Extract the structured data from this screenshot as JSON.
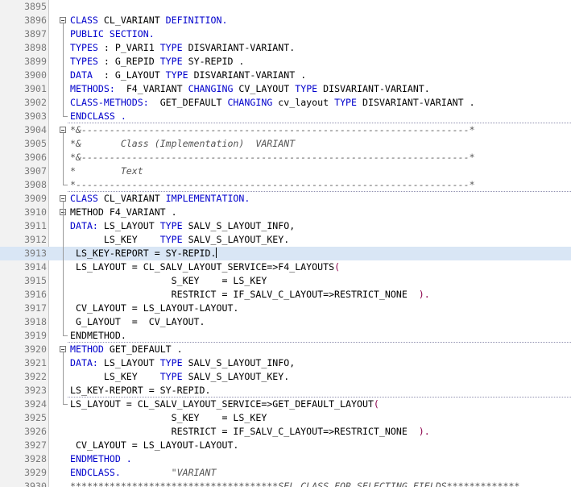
{
  "editor": {
    "lines": [
      {
        "no": "3895",
        "tokens": []
      },
      {
        "no": "3896",
        "tokens": [
          {
            "t": "CLASS ",
            "c": "kw"
          },
          {
            "t": "CL_VARIANT ",
            "c": "pl"
          },
          {
            "t": "DEFINITION.",
            "c": "kw"
          }
        ]
      },
      {
        "no": "3897",
        "tokens": [
          {
            "t": "PUBLIC SECTION.",
            "c": "kw"
          }
        ]
      },
      {
        "no": "3898",
        "tokens": [
          {
            "t": "TYPES ",
            "c": "kw"
          },
          {
            "t": ": P_VARI1 ",
            "c": "pl"
          },
          {
            "t": "TYPE ",
            "c": "kw"
          },
          {
            "t": "DISVARIANT-VARIANT.",
            "c": "pl"
          }
        ]
      },
      {
        "no": "3899",
        "tokens": [
          {
            "t": "TYPES ",
            "c": "kw"
          },
          {
            "t": ": G_REPID ",
            "c": "pl"
          },
          {
            "t": "TYPE ",
            "c": "kw"
          },
          {
            "t": "SY-REPID .",
            "c": "pl"
          }
        ]
      },
      {
        "no": "3900",
        "tokens": [
          {
            "t": "DATA  ",
            "c": "kw"
          },
          {
            "t": ": G_LAYOUT ",
            "c": "pl"
          },
          {
            "t": "TYPE ",
            "c": "kw"
          },
          {
            "t": "DISVARIANT-VARIANT .",
            "c": "pl"
          }
        ]
      },
      {
        "no": "3901",
        "tokens": [
          {
            "t": "METHODS:  ",
            "c": "kw"
          },
          {
            "t": "F4_VARIANT ",
            "c": "pl"
          },
          {
            "t": "CHANGING ",
            "c": "kw"
          },
          {
            "t": "CV_LAYOUT ",
            "c": "pl"
          },
          {
            "t": "TYPE ",
            "c": "kw"
          },
          {
            "t": "DISVARIANT-VARIANT.",
            "c": "pl"
          }
        ]
      },
      {
        "no": "3902",
        "tokens": [
          {
            "t": "CLASS-METHODS:  ",
            "c": "kw"
          },
          {
            "t": "GET_DEFAULT ",
            "c": "pl"
          },
          {
            "t": "CHANGING ",
            "c": "kw"
          },
          {
            "t": "cv_layout ",
            "c": "pl"
          },
          {
            "t": "TYPE ",
            "c": "kw"
          },
          {
            "t": "DISVARIANT-VARIANT .",
            "c": "pl"
          }
        ]
      },
      {
        "no": "3903",
        "tokens": [
          {
            "t": "ENDCLASS .",
            "c": "kw"
          }
        ]
      },
      {
        "no": "3904",
        "tokens": [
          {
            "t": "*&---------------------------------------------------------------------*",
            "c": "cmt"
          }
        ]
      },
      {
        "no": "3905",
        "tokens": [
          {
            "t": "*&       Class (Implementation)  VARIANT",
            "c": "cmt"
          }
        ]
      },
      {
        "no": "3906",
        "tokens": [
          {
            "t": "*&---------------------------------------------------------------------*",
            "c": "cmt"
          }
        ]
      },
      {
        "no": "3907",
        "tokens": [
          {
            "t": "*        Text",
            "c": "cmt"
          }
        ]
      },
      {
        "no": "3908",
        "tokens": [
          {
            "t": "*----------------------------------------------------------------------*",
            "c": "cmt"
          }
        ]
      },
      {
        "no": "3909",
        "tokens": [
          {
            "t": "CLASS ",
            "c": "kw"
          },
          {
            "t": "CL_VARIANT ",
            "c": "pl"
          },
          {
            "t": "IMPLEMENTATION.",
            "c": "kw"
          }
        ]
      },
      {
        "no": "3910",
        "tokens": [
          {
            "t": "METHOD F4_VARIANT .",
            "c": "pl"
          }
        ]
      },
      {
        "no": "3911",
        "tokens": [
          {
            "t": "DATA: ",
            "c": "kw"
          },
          {
            "t": "LS_LAYOUT ",
            "c": "pl"
          },
          {
            "t": "TYPE ",
            "c": "kw"
          },
          {
            "t": "SALV_S_LAYOUT_INFO,",
            "c": "pl"
          }
        ]
      },
      {
        "no": "3912",
        "tokens": [
          {
            "t": "      LS_KEY    ",
            "c": "pl"
          },
          {
            "t": "TYPE ",
            "c": "kw"
          },
          {
            "t": "SALV_S_LAYOUT_KEY.",
            "c": "pl"
          }
        ]
      },
      {
        "no": "3913",
        "tokens": [
          {
            "t": " LS_KEY-REPORT = SY-REPID.",
            "c": "pl"
          }
        ],
        "current": true
      },
      {
        "no": "3914",
        "tokens": [
          {
            "t": " LS_LAYOUT = CL_SALV_LAYOUT_SERVICE=>F4_LAYOUTS",
            "c": "pl"
          },
          {
            "t": "(",
            "c": "str"
          }
        ]
      },
      {
        "no": "3915",
        "tokens": [
          {
            "t": "                  S_KEY    = LS_KEY",
            "c": "pl"
          }
        ]
      },
      {
        "no": "3916",
        "tokens": [
          {
            "t": "                  RESTRICT = IF_SALV_C_LAYOUT=>RESTRICT_NONE  ",
            "c": "pl"
          },
          {
            "t": ").",
            "c": "str"
          }
        ]
      },
      {
        "no": "3917",
        "tokens": [
          {
            "t": " CV_LAYOUT = LS_LAYOUT-LAYOUT.",
            "c": "pl"
          }
        ]
      },
      {
        "no": "3918",
        "tokens": [
          {
            "t": " G_LAYOUT  =  CV_LAYOUT.",
            "c": "pl"
          }
        ]
      },
      {
        "no": "3919",
        "tokens": [
          {
            "t": "ENDMETHOD.",
            "c": "pl"
          }
        ]
      },
      {
        "no": "3920",
        "tokens": [
          {
            "t": "METHOD ",
            "c": "kw"
          },
          {
            "t": "GET_DEFAULT .",
            "c": "pl"
          }
        ]
      },
      {
        "no": "3921",
        "tokens": [
          {
            "t": "DATA: ",
            "c": "kw"
          },
          {
            "t": "LS_LAYOUT ",
            "c": "pl"
          },
          {
            "t": "TYPE ",
            "c": "kw"
          },
          {
            "t": "SALV_S_LAYOUT_INFO,",
            "c": "pl"
          }
        ]
      },
      {
        "no": "3922",
        "tokens": [
          {
            "t": "      LS_KEY    ",
            "c": "pl"
          },
          {
            "t": "TYPE ",
            "c": "kw"
          },
          {
            "t": "SALV_S_LAYOUT_KEY.",
            "c": "pl"
          }
        ]
      },
      {
        "no": "3923",
        "tokens": [
          {
            "t": "LS_KEY-REPORT = SY-REPID.",
            "c": "pl"
          }
        ]
      },
      {
        "no": "3924",
        "tokens": [
          {
            "t": "LS_LAYOUT = CL_SALV_LAYOUT_SERVICE=>GET_DEFAULT_LAYOUT",
            "c": "pl"
          },
          {
            "t": "(",
            "c": "str"
          }
        ]
      },
      {
        "no": "3925",
        "tokens": [
          {
            "t": "                  S_KEY    = LS_KEY",
            "c": "pl"
          }
        ]
      },
      {
        "no": "3926",
        "tokens": [
          {
            "t": "                  RESTRICT = IF_SALV_C_LAYOUT=>RESTRICT_NONE  ",
            "c": "pl"
          },
          {
            "t": ").",
            "c": "str"
          }
        ]
      },
      {
        "no": "3927",
        "tokens": [
          {
            "t": " CV_LAYOUT = LS_LAYOUT-LAYOUT.",
            "c": "pl"
          }
        ]
      },
      {
        "no": "3928",
        "tokens": [
          {
            "t": "ENDMETHOD .",
            "c": "kw"
          }
        ]
      },
      {
        "no": "3929",
        "tokens": [
          {
            "t": "ENDCLASS.         ",
            "c": "kw"
          },
          {
            "t": "\"VARIANT",
            "c": "cmt"
          }
        ]
      },
      {
        "no": "3930",
        "tokens": [
          {
            "t": "*************************************SEL CLASS FOR SELECTING FIELDS*************",
            "c": "cmt"
          }
        ]
      }
    ]
  },
  "colors": {
    "keyword": "#0000cc",
    "comment": "#555555",
    "bracket": "#8b004b",
    "current_line": "#d9e6f5"
  },
  "icons": {
    "fold": "fold-minus-icon"
  }
}
